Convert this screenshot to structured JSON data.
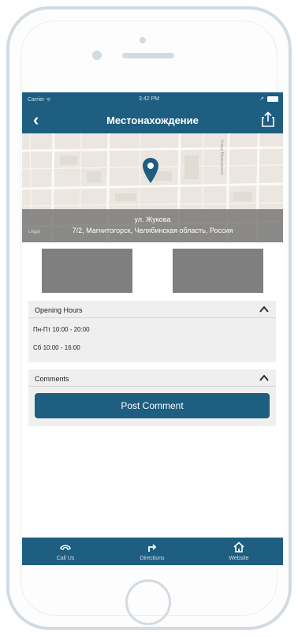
{
  "status_bar": {
    "carrier": "Carrier ᯤ",
    "time": "3:42 PM"
  },
  "nav": {
    "title": "Местонахождение",
    "back_icon": "chevron-left-icon",
    "share_icon": "share-icon"
  },
  "map": {
    "street_label": "ул. Жукова",
    "address_label": "7/2, Магнитогорск, Челябинская область, Россия",
    "legal_label": "Legal",
    "vertical_street": "Улица Маяковского",
    "pin_icon": "map-pin-icon"
  },
  "sections": {
    "opening_hours": {
      "title": "Opening Hours",
      "rows": [
        "Пн-Пт 10:00 - 20:00",
        "Сб 10:00 - 16:00"
      ]
    },
    "comments": {
      "title": "Comments",
      "post_button": "Post Comment"
    }
  },
  "tabbar": {
    "items": [
      {
        "label": "Call Us",
        "icon": "phone-icon"
      },
      {
        "label": "Directions",
        "icon": "directions-icon"
      },
      {
        "label": "Website",
        "icon": "home-icon"
      }
    ]
  },
  "colors": {
    "brand": "#1e5e80",
    "section_bg": "#efefef",
    "photo_placeholder": "#7f7f7f"
  }
}
